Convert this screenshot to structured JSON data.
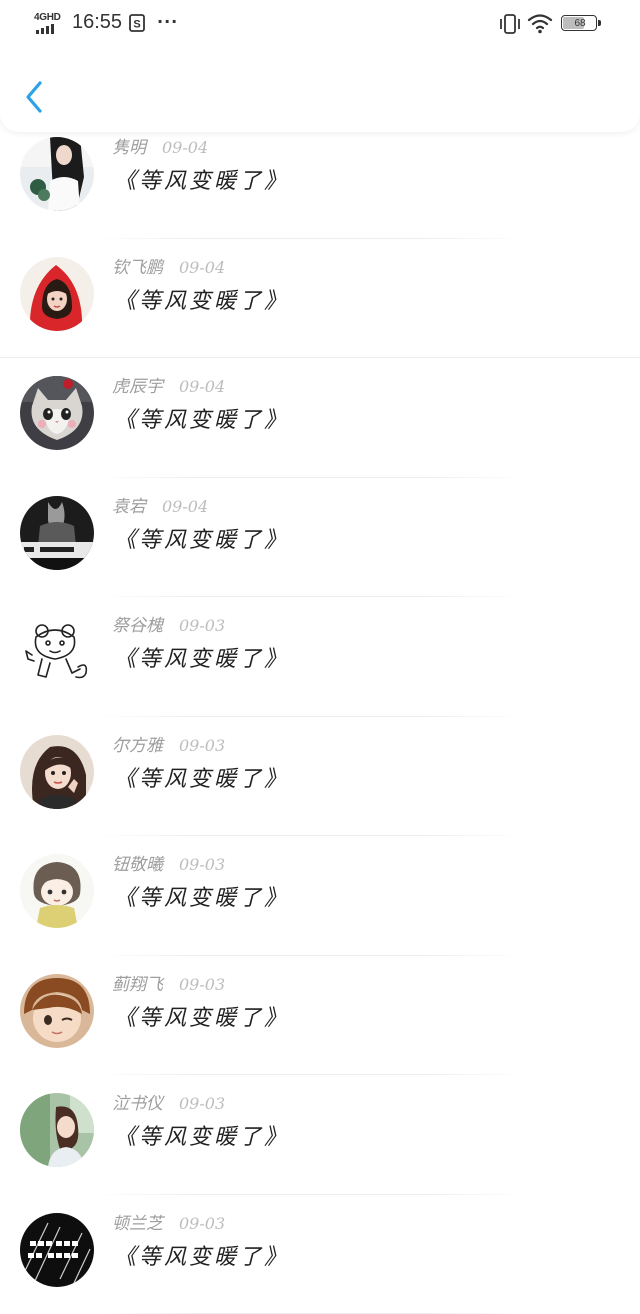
{
  "status_bar": {
    "network": "4GHD",
    "time": "16:55",
    "more": "···",
    "battery_level": "68",
    "battery_fraction": 0.68,
    "icons": [
      "signal-icon",
      "sim-icon",
      "vibrate-icon",
      "wifi-icon",
      "battery-icon"
    ]
  },
  "header": {
    "back_icon": "chevron-left-icon",
    "accent_color": "#2aa1e8"
  },
  "list": {
    "items": [
      {
        "name": "隽明",
        "date": "09-04",
        "title": "《等风变暖了》",
        "avatar": "girl-dark-hair"
      },
      {
        "name": "钦飞鹏",
        "date": "09-04",
        "title": "《等风变暖了》",
        "avatar": "girl-red-hood"
      },
      {
        "name": "虎辰宇",
        "date": "09-04",
        "title": "《等风变暖了》",
        "avatar": "kitten"
      },
      {
        "name": "袁宕",
        "date": "09-04",
        "title": "《等风变暖了》",
        "avatar": "dark-photo"
      },
      {
        "name": "祭谷槐",
        "date": "09-03",
        "title": "《等风变暖了》",
        "avatar": "tiger-sketch"
      },
      {
        "name": "尔方雅",
        "date": "09-03",
        "title": "《等风变暖了》",
        "avatar": "girl-selfie"
      },
      {
        "name": "钮敬曦",
        "date": "09-03",
        "title": "《等风变暖了》",
        "avatar": "cartoon-kid"
      },
      {
        "name": "蓟翔飞",
        "date": "09-03",
        "title": "《等风变暖了》",
        "avatar": "anime-boy"
      },
      {
        "name": "泣书仪",
        "date": "09-03",
        "title": "《等风变暖了》",
        "avatar": "girl-outdoor"
      },
      {
        "name": "顿兰芝",
        "date": "09-03",
        "title": "《等风变暖了》",
        "avatar": "black-text"
      }
    ]
  }
}
